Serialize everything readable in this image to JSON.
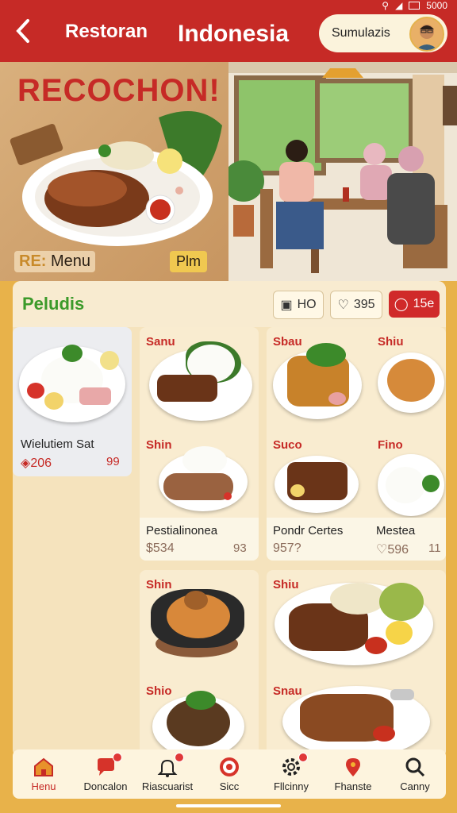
{
  "header": {
    "back_icon": "chevron-left-icon",
    "left_label": "Restoran",
    "title": "Indonesia",
    "user_name": "Sumulazis",
    "status_text": "5000",
    "accent": "#c62a26"
  },
  "hero": {
    "title": "RECOCHON!",
    "menu_prefix": "RE:",
    "menu_label": "Menu",
    "pill_label": "Plm"
  },
  "panel": {
    "title": "Peludis",
    "ho_label": "HO",
    "likes": "395",
    "comments": "15e"
  },
  "cards": [
    {
      "name": "Wielutiem Sat",
      "price": "206",
      "count": "99"
    },
    {
      "label_top": "Sanu",
      "label_mid": "Shin",
      "name": "Pestialinonea",
      "price": "$534",
      "count": "93"
    },
    {
      "label_top": "Sbau",
      "label_mid": "Suco",
      "name": "Pondr Certes",
      "price": "957?"
    },
    {
      "label_top": "Shiu",
      "label_mid": "Fino",
      "name": "Mestea",
      "price": "596",
      "count": "11"
    },
    {
      "label_top": "Shin",
      "label_mid": "Shio"
    },
    {
      "label_top": "Shiu",
      "label_mid": "Snau"
    }
  ],
  "nav": [
    {
      "label": "Henu",
      "icon": "home-icon"
    },
    {
      "label": "Doncalon",
      "icon": "chat-icon"
    },
    {
      "label": "Riascuarist",
      "icon": "bell-icon"
    },
    {
      "label": "Sicc",
      "icon": "target-icon"
    },
    {
      "label": "Fllcinny",
      "icon": "gear-icon"
    },
    {
      "label": "Fhanste",
      "icon": "location-icon"
    },
    {
      "label": "Canny",
      "icon": "search-icon"
    }
  ]
}
